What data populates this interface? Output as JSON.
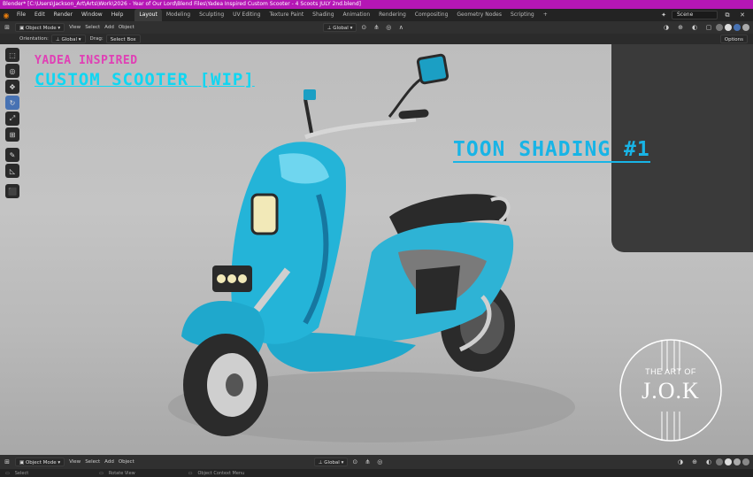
{
  "titlebar": {
    "text": "Blender* [C:\\Users\\Jackson_Art\\Arts\\Work\\2026 - Year of Our Lord\\Blend Files\\Yadea Inspired Custom Scooter - 4 Scoots JULY 2nd.blend]"
  },
  "menu": {
    "items": [
      "File",
      "Edit",
      "Render",
      "Window",
      "Help"
    ]
  },
  "workspaces": [
    "Layout",
    "Modeling",
    "Sculpting",
    "UV Editing",
    "Texture Paint",
    "Shading",
    "Animation",
    "Rendering",
    "Compositing",
    "Geometry Nodes",
    "Scripting",
    "+"
  ],
  "scene": {
    "label": "Scene"
  },
  "header": {
    "mode": "Object Mode",
    "view": "View",
    "select": "Select",
    "add": "Add",
    "object": "Object",
    "orientation": "Global",
    "options": "Options"
  },
  "tool_settings": {
    "orientation_label": "Orientation:",
    "orientation_value": "Global",
    "drag_label": "Drag:",
    "drag_value": "Select Box"
  },
  "overlay": {
    "line1": "YADEA INSPIRED",
    "line2": "CUSTOM SCOOTER [WIP]",
    "line3": "TOON SHADING #1"
  },
  "watermark": {
    "line1": "THE ART OF",
    "line2": "J.O.K"
  },
  "bottom_header": {
    "mode": "Object Mode",
    "view": "View",
    "select": "Select",
    "add": "Add",
    "object": "Object",
    "orientation": "Global"
  },
  "status": {
    "select": "Select",
    "rotate": "Rotate View",
    "context": "Object Context Menu"
  },
  "colors": {
    "title_bar": "#b516b5",
    "accent_blue": "#4772b3",
    "text_pink": "#e040b5",
    "text_cyan": "#10d6f2",
    "scooter_body": "#1fb0d0"
  }
}
